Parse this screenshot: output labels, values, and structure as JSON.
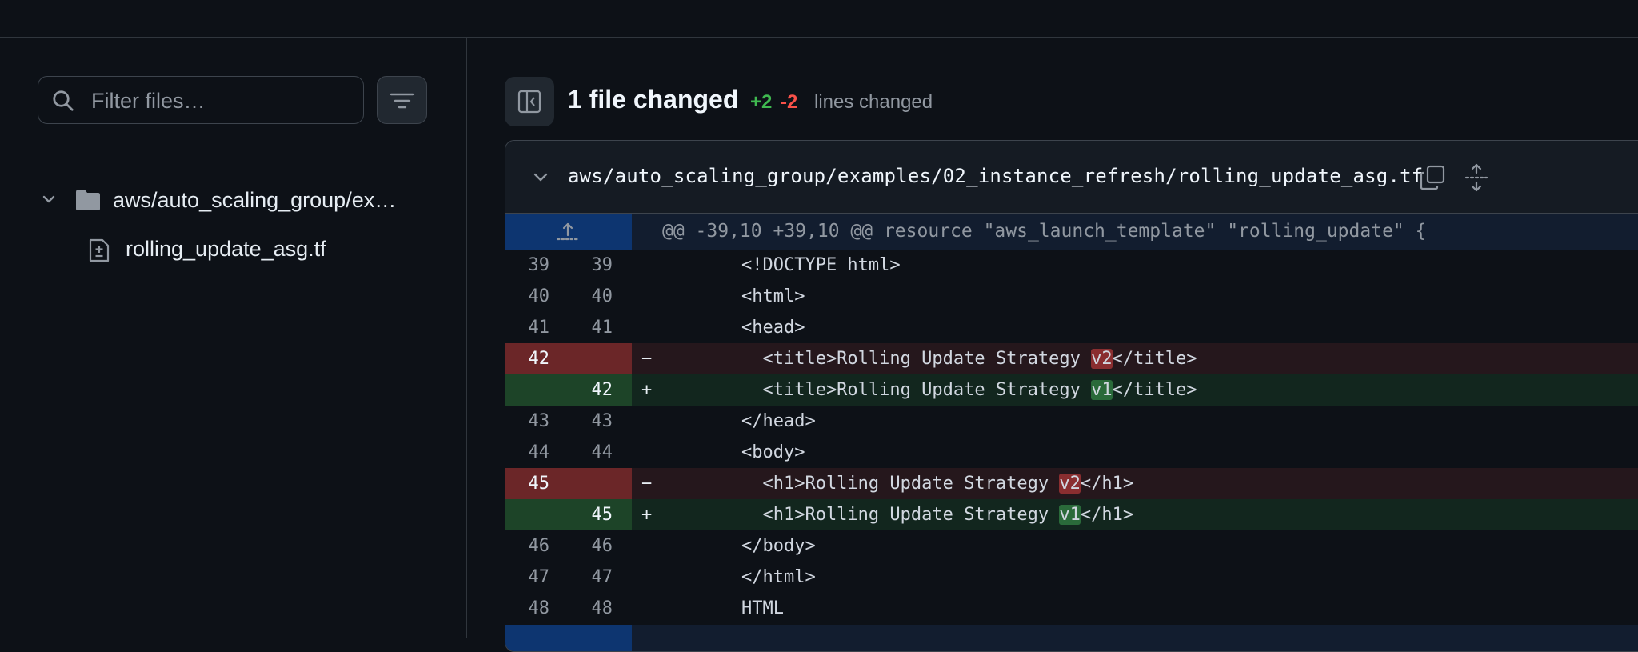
{
  "sidebar": {
    "filter_placeholder": "Filter files…",
    "folder_label": "aws/auto_scaling_group/ex…",
    "file_label": "rolling_update_asg.tf"
  },
  "summary": {
    "title": "1 file changed",
    "additions": "+2",
    "deletions": "-2",
    "lines_label": "lines changed"
  },
  "file": {
    "path": "aws/auto_scaling_group/examples/02_instance_refresh/rolling_update_asg.tf",
    "hunk_header": "@@ -39,10 +39,10 @@ resource \"aws_launch_template\" \"rolling_update\" {",
    "lines": [
      {
        "type": "ctx",
        "old": "39",
        "new": "39",
        "sign": "",
        "code": "    <!DOCTYPE html>"
      },
      {
        "type": "ctx",
        "old": "40",
        "new": "40",
        "sign": "",
        "code": "    <html>"
      },
      {
        "type": "ctx",
        "old": "41",
        "new": "41",
        "sign": "",
        "code": "    <head>"
      },
      {
        "type": "del",
        "old": "42",
        "new": "",
        "sign": "−",
        "code_pre": "      <title>Rolling Update Strategy ",
        "hl": "v2",
        "code_post": "</title>"
      },
      {
        "type": "add",
        "old": "",
        "new": "42",
        "sign": "+",
        "code_pre": "      <title>Rolling Update Strategy ",
        "hl": "v1",
        "code_post": "</title>"
      },
      {
        "type": "ctx",
        "old": "43",
        "new": "43",
        "sign": "",
        "code": "    </head>"
      },
      {
        "type": "ctx",
        "old": "44",
        "new": "44",
        "sign": "",
        "code": "    <body>"
      },
      {
        "type": "del",
        "old": "45",
        "new": "",
        "sign": "−",
        "code_pre": "      <h1>Rolling Update Strategy ",
        "hl": "v2",
        "code_post": "</h1>"
      },
      {
        "type": "add",
        "old": "",
        "new": "45",
        "sign": "+",
        "code_pre": "      <h1>Rolling Update Strategy ",
        "hl": "v1",
        "code_post": "</h1>"
      },
      {
        "type": "ctx",
        "old": "46",
        "new": "46",
        "sign": "",
        "code": "    </body>"
      },
      {
        "type": "ctx",
        "old": "47",
        "new": "47",
        "sign": "",
        "code": "    </html>"
      },
      {
        "type": "ctx",
        "old": "48",
        "new": "48",
        "sign": "",
        "code": "    HTML"
      }
    ]
  }
}
